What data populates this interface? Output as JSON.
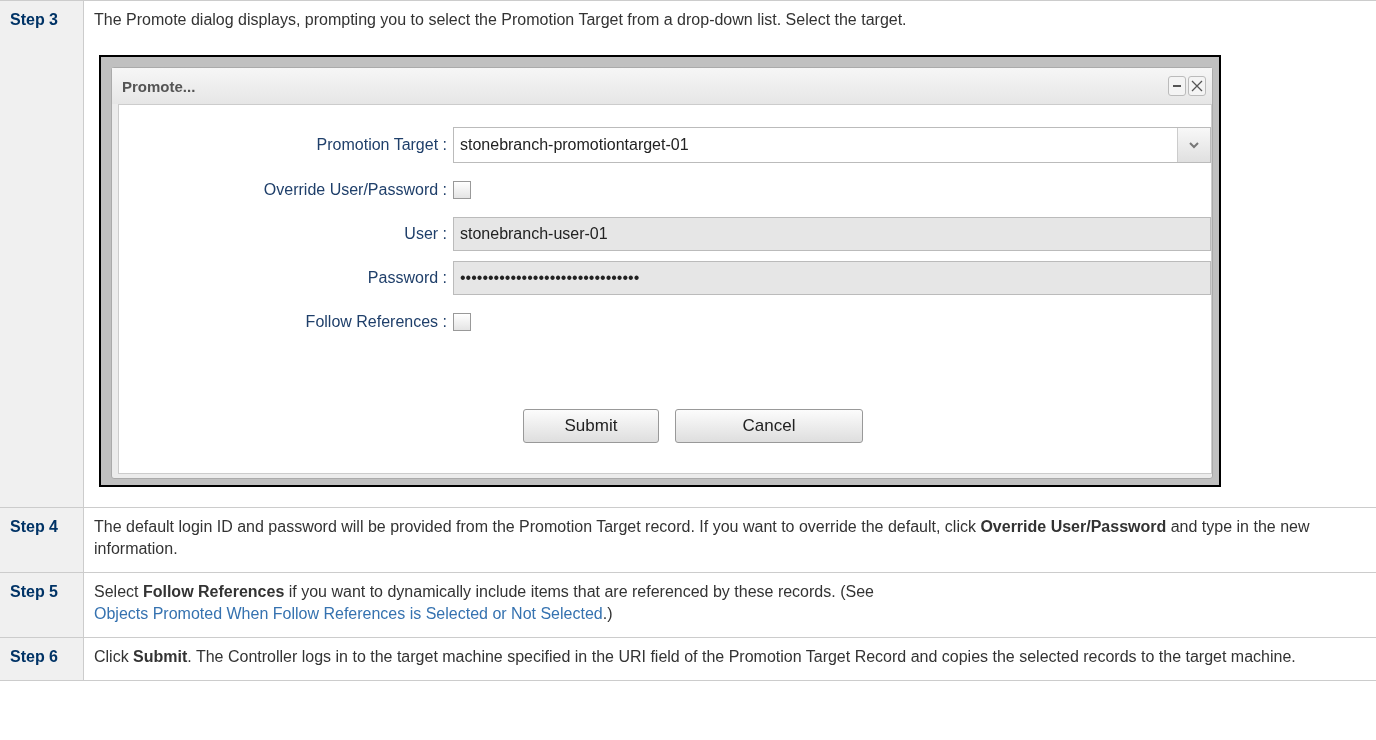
{
  "steps": [
    {
      "label": "Step 3",
      "text": "The Promote dialog displays, prompting you to select the Promotion Target from a drop-down list. Select the target.",
      "dialog": {
        "title": "Promote...",
        "fields": [
          {
            "kind": "select",
            "label": "Promotion Target :",
            "value": "stonebranch-promotiontarget-01",
            "disabled": false
          },
          {
            "kind": "checkbox",
            "label": "Override User/Password :",
            "checked": false
          },
          {
            "kind": "text",
            "label": "User :",
            "value": "stonebranch-user-01",
            "disabled": true
          },
          {
            "kind": "text",
            "label": "Password :",
            "value": "••••••••••••••••••••••••••••••••",
            "disabled": true
          },
          {
            "kind": "checkbox",
            "label": "Follow References :",
            "checked": false
          }
        ],
        "buttons": [
          "Submit",
          "Cancel"
        ]
      }
    },
    {
      "label": "Step 4",
      "text": "The default login ID and password will be provided from the Promotion Target record. If you want to override the default, click **Override User/Password** and type in the new information."
    },
    {
      "label": "Step 5",
      "text": "Select **Follow References** if you want to dynamically include items that are referenced by these records. (See ",
      "link": "Objects Promoted When Follow References is Selected or Not Selected",
      "after": ".)"
    },
    {
      "label": "Step 6",
      "text": "Click **Submit**. The Controller logs in to the target machine specified in the URI field of the Promotion Target Record and copies the selected records to the target machine."
    }
  ]
}
